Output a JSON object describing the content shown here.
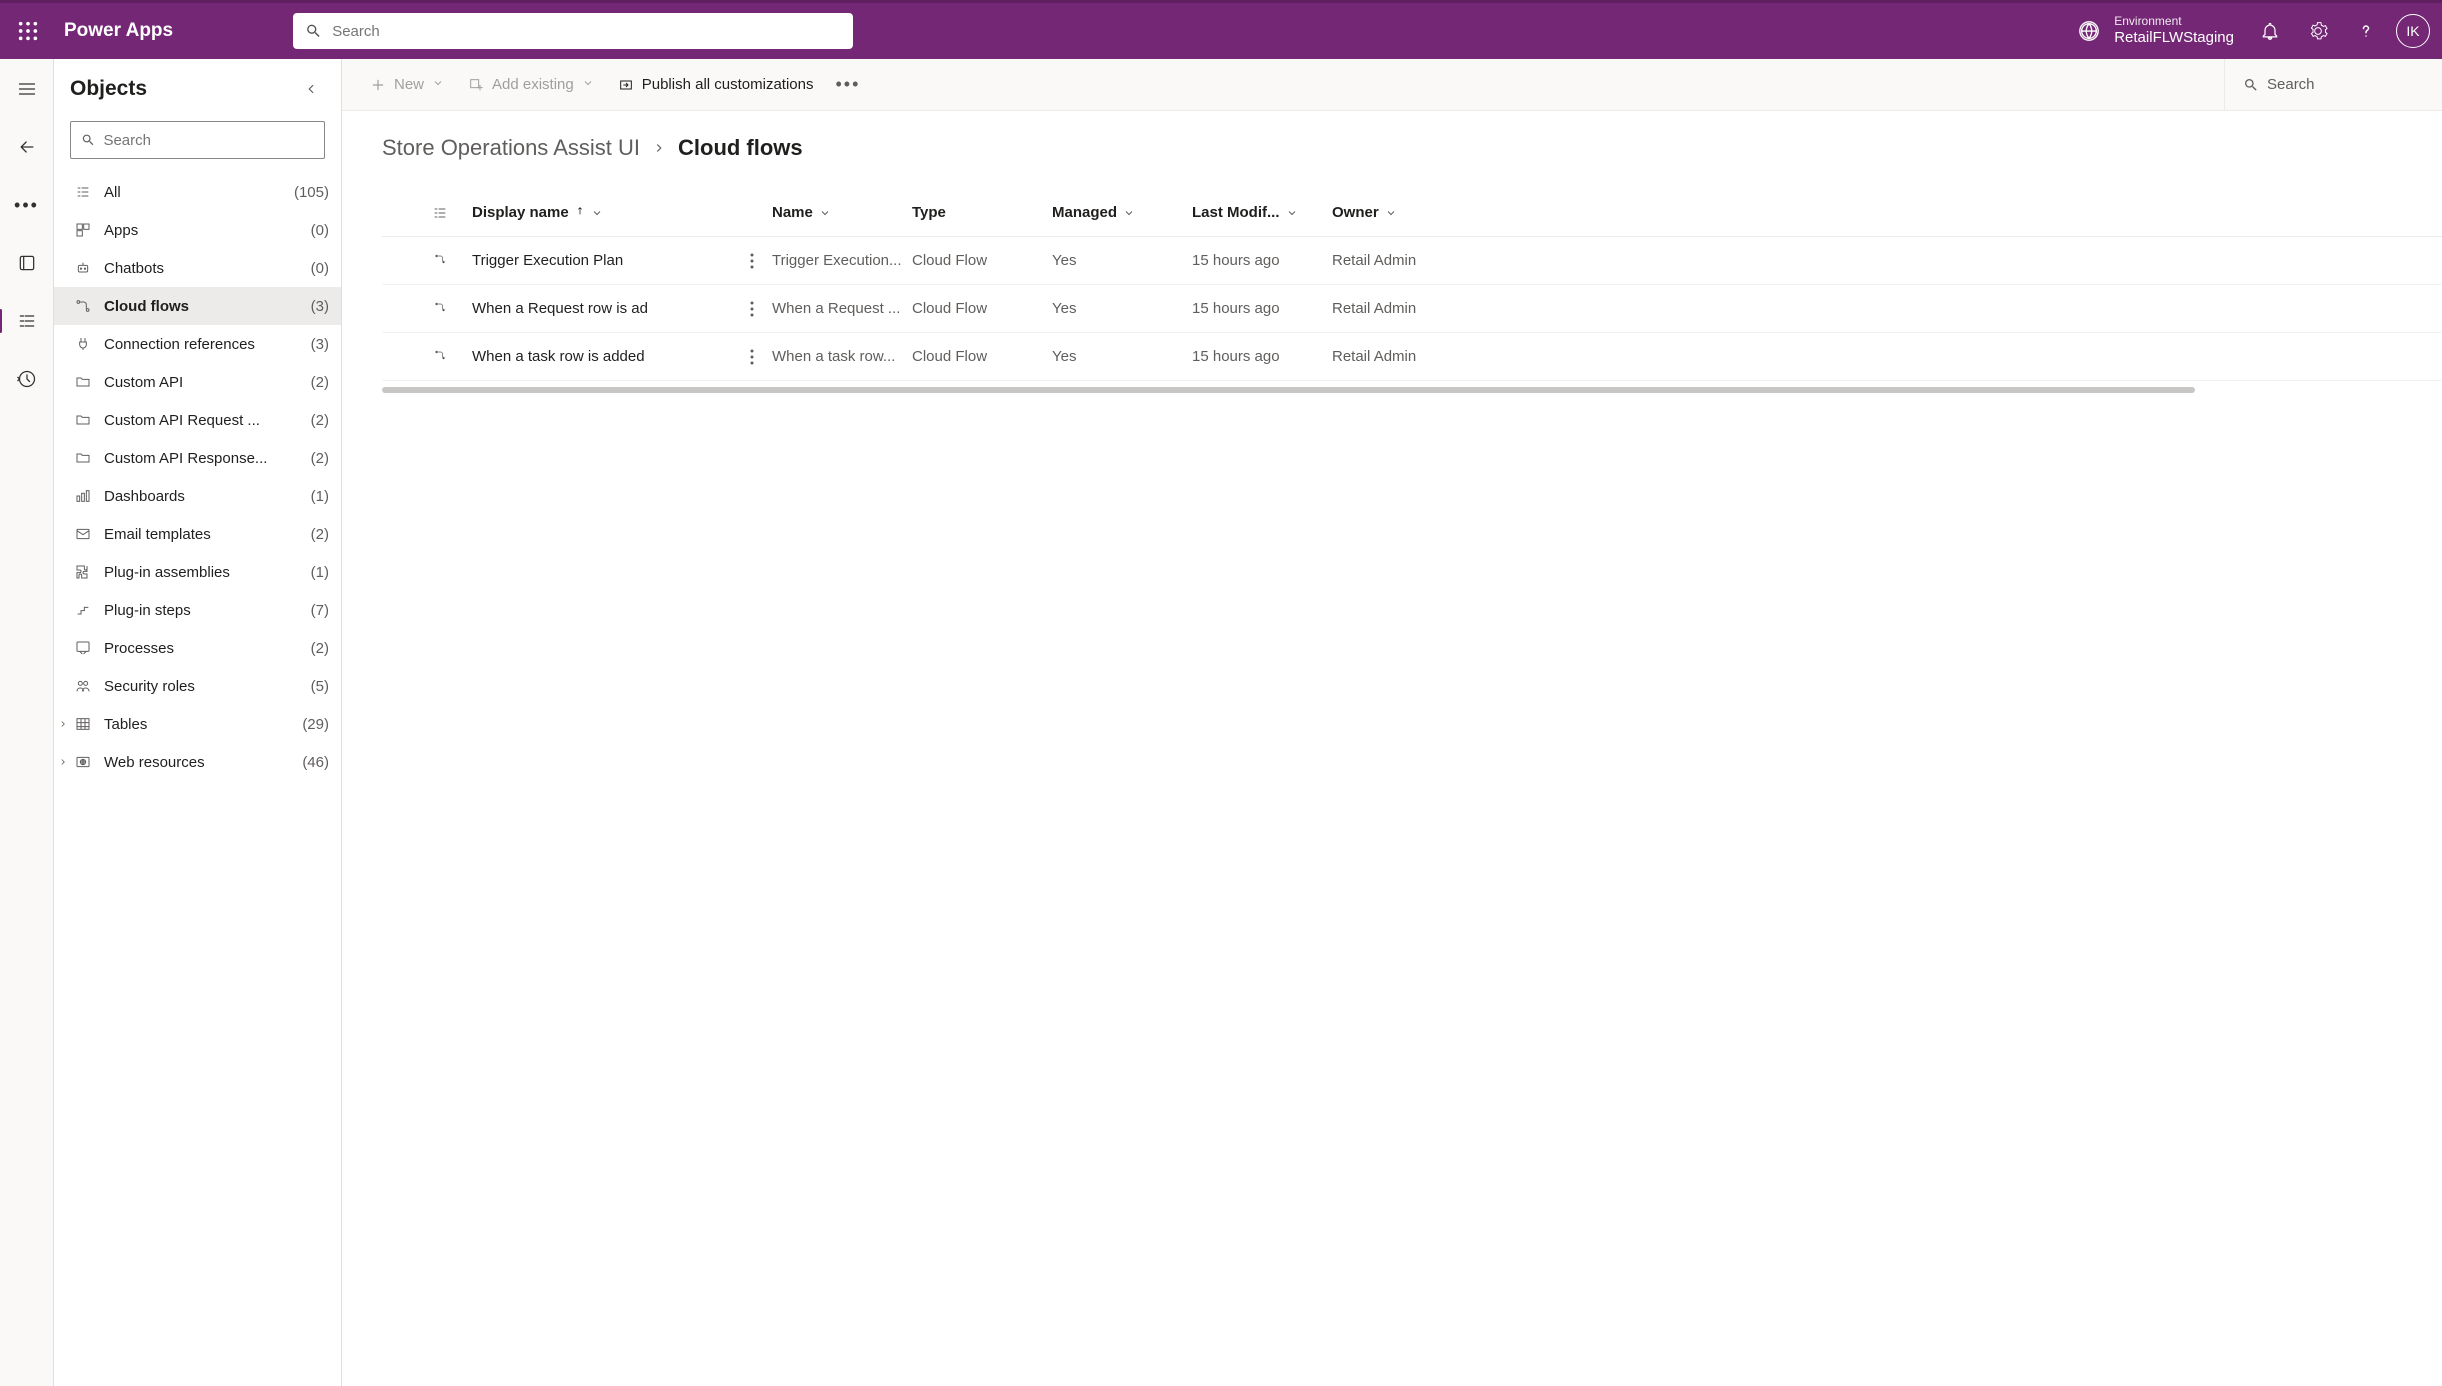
{
  "header": {
    "app_name": "Power Apps",
    "search_placeholder": "Search",
    "env_label": "Environment",
    "env_name": "RetailFLWStaging",
    "avatar_initials": "IK"
  },
  "sidebar": {
    "title": "Objects",
    "search_placeholder": "Search",
    "items": [
      {
        "label": "All",
        "count": "(105)",
        "icon": "list"
      },
      {
        "label": "Apps",
        "count": "(0)",
        "icon": "apps"
      },
      {
        "label": "Chatbots",
        "count": "(0)",
        "icon": "bot"
      },
      {
        "label": "Cloud flows",
        "count": "(3)",
        "icon": "flow",
        "selected": true
      },
      {
        "label": "Connection references",
        "count": "(3)",
        "icon": "plug"
      },
      {
        "label": "Custom API",
        "count": "(2)",
        "icon": "folder"
      },
      {
        "label": "Custom API Request ...",
        "count": "(2)",
        "icon": "folder"
      },
      {
        "label": "Custom API Response...",
        "count": "(2)",
        "icon": "folder"
      },
      {
        "label": "Dashboards",
        "count": "(1)",
        "icon": "dashboard"
      },
      {
        "label": "Email templates",
        "count": "(2)",
        "icon": "mail"
      },
      {
        "label": "Plug-in assemblies",
        "count": "(1)",
        "icon": "puzzle"
      },
      {
        "label": "Plug-in steps",
        "count": "(7)",
        "icon": "step"
      },
      {
        "label": "Processes",
        "count": "(2)",
        "icon": "process"
      },
      {
        "label": "Security roles",
        "count": "(5)",
        "icon": "roles"
      },
      {
        "label": "Tables",
        "count": "(29)",
        "icon": "table",
        "chevron": true
      },
      {
        "label": "Web resources",
        "count": "(46)",
        "icon": "web",
        "chevron": true
      }
    ]
  },
  "cmdbar": {
    "new": "New",
    "add_existing": "Add existing",
    "publish": "Publish all customizations",
    "search": "Search"
  },
  "breadcrumb": {
    "root": "Store Operations Assist UI",
    "current": "Cloud flows"
  },
  "columns": {
    "display_name": "Display name",
    "name": "Name",
    "type": "Type",
    "managed": "Managed",
    "last_modified": "Last Modif...",
    "owner": "Owner"
  },
  "rows": [
    {
      "display_name": "Trigger Execution Plan",
      "name": "Trigger Execution...",
      "type": "Cloud Flow",
      "managed": "Yes",
      "modified": "15 hours ago",
      "owner": "Retail Admin"
    },
    {
      "display_name": "When a Request row is ad",
      "name": "When a Request ...",
      "type": "Cloud Flow",
      "managed": "Yes",
      "modified": "15 hours ago",
      "owner": "Retail Admin"
    },
    {
      "display_name": "When a task row is added",
      "name": "When a task row...",
      "type": "Cloud Flow",
      "managed": "Yes",
      "modified": "15 hours ago",
      "owner": "Retail Admin"
    }
  ]
}
